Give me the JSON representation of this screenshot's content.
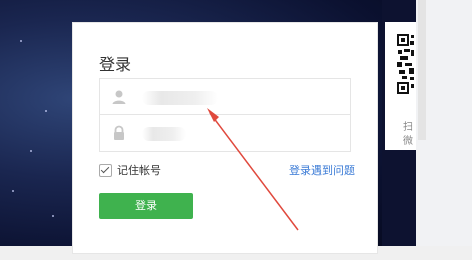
{
  "login": {
    "title": "登录",
    "remember_label": "记住帐号",
    "help_link": "登录遇到问题",
    "submit_label": "登录"
  },
  "qr_panel": {
    "text_1": "扫",
    "text_2": "微"
  },
  "colors": {
    "accent_green": "#3fb24e",
    "link_blue": "#3b7bd6",
    "arrow_red": "#e0493d"
  },
  "icons": {
    "user_field": "user-icon",
    "password_field": "lock-icon"
  }
}
